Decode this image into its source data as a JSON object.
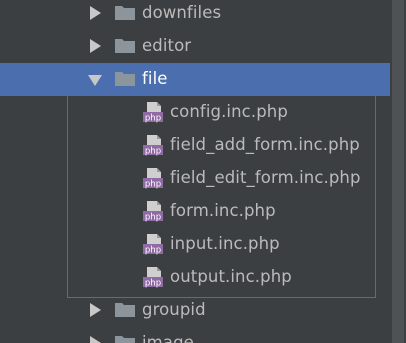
{
  "tree": {
    "items": [
      {
        "kind": "folder",
        "label": "downfiles",
        "expanded": false
      },
      {
        "kind": "folder",
        "label": "editor",
        "expanded": false
      },
      {
        "kind": "folder",
        "label": "file",
        "expanded": true,
        "selected": true
      },
      {
        "kind": "file",
        "label": "config.inc.php",
        "icon": "php-file-icon"
      },
      {
        "kind": "file",
        "label": "field_add_form.inc.php",
        "icon": "php-file-icon"
      },
      {
        "kind": "file",
        "label": "field_edit_form.inc.php",
        "icon": "php-file-icon"
      },
      {
        "kind": "file",
        "label": "form.inc.php",
        "icon": "php-file-icon"
      },
      {
        "kind": "file",
        "label": "input.inc.php",
        "icon": "php-file-icon"
      },
      {
        "kind": "file",
        "label": "output.inc.php",
        "icon": "php-file-icon"
      },
      {
        "kind": "folder",
        "label": "groupid",
        "expanded": false
      },
      {
        "kind": "folder",
        "label": "image",
        "expanded": false
      }
    ]
  },
  "file_icon_text": "php",
  "colors": {
    "background": "#3c3f41",
    "selection": "#4b6eaf",
    "text": "#bbbbbb",
    "folder": "#8c959c",
    "php_badge": "#8f6aa5",
    "highlight_box": "#c8404b"
  }
}
